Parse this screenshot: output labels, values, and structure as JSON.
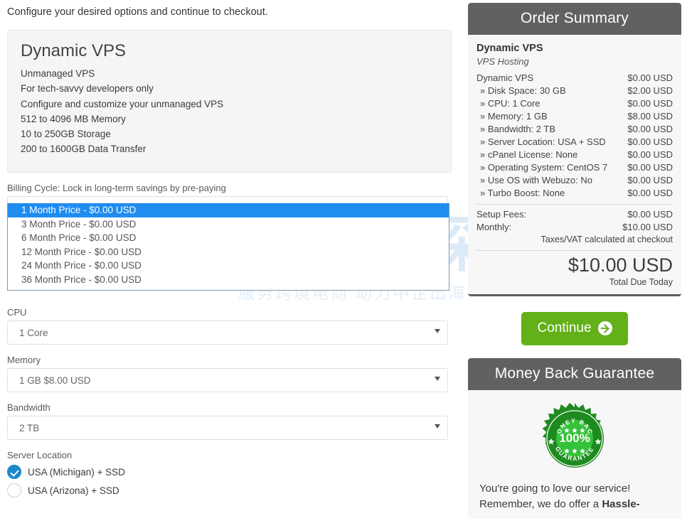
{
  "intro": {
    "text": "Configure your desired options and continue to checkout."
  },
  "product": {
    "title": "Dynamic VPS",
    "features": [
      "Unmanaged VPS",
      "For tech-savvy developers only",
      "Configure and customize your unmanaged VPS",
      "512 to 4096 MB Memory",
      "10 to 250GB Storage",
      "200 to 1600GB Data Transfer"
    ]
  },
  "form": {
    "billing_cycle": {
      "label": "Billing Cycle: Lock in long-term savings by pre-paying",
      "value": "1 Month Price - $0.00 USD",
      "expanded": true,
      "options": [
        "1 Month Price - $0.00 USD",
        "3 Month Price - $0.00 USD",
        "6 Month Price - $0.00 USD",
        "12 Month Price - $0.00 USD",
        "24 Month Price - $0.00 USD",
        "36 Month Price - $0.00 USD"
      ],
      "selected_index": 0
    },
    "cpu": {
      "label": "CPU",
      "value": "1 Core"
    },
    "memory": {
      "label": "Memory",
      "value": "1 GB $8.00 USD"
    },
    "bandwidth": {
      "label": "Bandwidth",
      "value": "2 TB"
    },
    "server_location": {
      "label": "Server Location",
      "options": [
        {
          "label": "USA (Michigan) + SSD",
          "checked": true
        },
        {
          "label": "USA (Arizona) + SSD",
          "checked": false
        }
      ]
    }
  },
  "order_summary": {
    "header": "Order Summary",
    "product_name": "Dynamic VPS",
    "product_group": "VPS Hosting",
    "lines": [
      {
        "label": "Dynamic VPS",
        "amount": "$0.00 USD",
        "sub": false
      },
      {
        "label": "» Disk Space: 30 GB",
        "amount": "$2.00 USD",
        "sub": true
      },
      {
        "label": "» CPU: 1 Core",
        "amount": "$0.00 USD",
        "sub": true
      },
      {
        "label": "» Memory: 1 GB",
        "amount": "$8.00 USD",
        "sub": true
      },
      {
        "label": "» Bandwidth: 2 TB",
        "amount": "$0.00 USD",
        "sub": true
      },
      {
        "label": "» Server Location: USA + SSD",
        "amount": "$0.00 USD",
        "sub": true
      },
      {
        "label": "» cPanel License: None",
        "amount": "$0.00 USD",
        "sub": true
      },
      {
        "label": "» Operating System: CentOS 7",
        "amount": "$0.00 USD",
        "sub": true
      },
      {
        "label": "» Use OS with Webuzo: No",
        "amount": "$0.00 USD",
        "sub": true
      },
      {
        "label": "» Turbo Boost: None",
        "amount": "$0.00 USD",
        "sub": true
      }
    ],
    "setup_fees_label": "Setup Fees:",
    "setup_fees_amount": "$0.00 USD",
    "monthly_label": "Monthly:",
    "monthly_amount": "$10.00 USD",
    "tax_note": "Taxes/VAT calculated at checkout",
    "total_amount": "$10.00 USD",
    "total_caption": "Total Due Today"
  },
  "continue_button": {
    "label": "Continue"
  },
  "money_back": {
    "header": "Money Back Guarantee",
    "seal": {
      "top_text": "MONEY BACK",
      "percent": "100%",
      "bottom_text": "GUARANTEE"
    },
    "body_line1": "You're going to love our service!",
    "body_line2_prefix": "Remember, we do offer a ",
    "body_line2_bold": "Hassle-"
  },
  "watermark": {
    "main": "主机侦探",
    "sub": "服务跨境电商 助力中企出海"
  },
  "colors": {
    "panel_header": "#616161",
    "continue_green": "#63b018",
    "highlight_blue": "#1f8cf0",
    "radio_blue": "#1c87c9",
    "seal_green": "#22a522"
  }
}
